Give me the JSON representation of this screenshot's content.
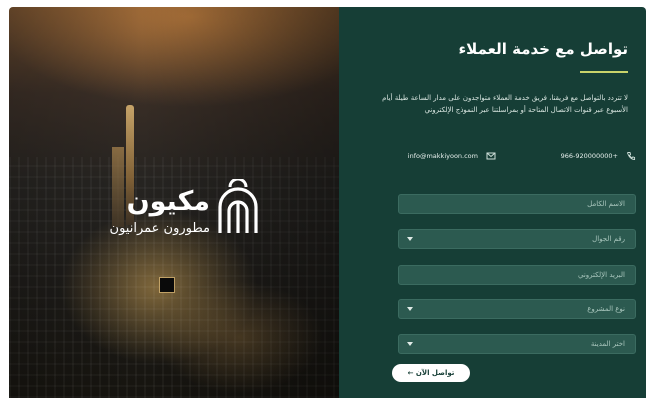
{
  "brand": {
    "name": "مكيون",
    "tagline": "مطورون عمرانيون"
  },
  "contact_form": {
    "title": "تواصل مع خدمة العملاء",
    "description": "لا تتردد بالتواصل مع فريقنا، فريق خدمة العملاء متواجدون على مدار الساعة طيلة أيام الأسبوع عبر قنوات الاتصال المتاحة أو بمراسلتنا عبر النموذج الإلكتروني",
    "email": "info@makkiyoon.com",
    "phone": "966-920000000+",
    "fields": {
      "full_name_placeholder": "الاسم الكامل",
      "mobile_placeholder": "رقم الجوال",
      "email_placeholder": "البريد الإلكتروني",
      "project_type_placeholder": "نوع المشروع",
      "city_placeholder": "اختر المدينة"
    },
    "submit_label": "تواصل الآن ←"
  },
  "colors": {
    "panel_bg": "#163e36",
    "field_bg": "#2c5a50",
    "accent_line": "#c9d36a"
  },
  "icons": {
    "email": "mail-icon",
    "phone": "phone-icon",
    "logo": "makkiyoon-logo-mark"
  }
}
